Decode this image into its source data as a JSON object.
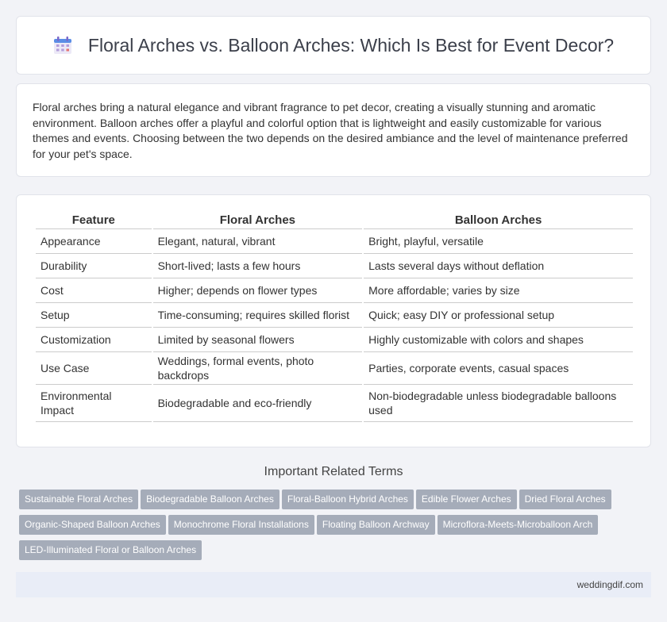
{
  "header": {
    "title": "Floral Arches vs. Balloon Arches: Which Is Best for Event Decor?",
    "icon": "calendar-icon"
  },
  "intro": {
    "text": "Floral arches bring a natural elegance and vibrant fragrance to pet decor, creating a visually stunning and aromatic environment. Balloon arches offer a playful and colorful option that is lightweight and easily customizable for various themes and events. Choosing between the two depends on the desired ambiance and the level of maintenance preferred for your pet's space."
  },
  "table": {
    "headers": [
      "Feature",
      "Floral Arches",
      "Balloon Arches"
    ],
    "rows": [
      [
        "Appearance",
        "Elegant, natural, vibrant",
        "Bright, playful, versatile"
      ],
      [
        "Durability",
        "Short-lived; lasts a few hours",
        "Lasts several days without deflation"
      ],
      [
        "Cost",
        "Higher; depends on flower types",
        "More affordable; varies by size"
      ],
      [
        "Setup",
        "Time-consuming; requires skilled florist",
        "Quick; easy DIY or professional setup"
      ],
      [
        "Customization",
        "Limited by seasonal flowers",
        "Highly customizable with colors and shapes"
      ],
      [
        "Use Case",
        "Weddings, formal events, photo backdrops",
        "Parties, corporate events, casual spaces"
      ],
      [
        "Environmental Impact",
        "Biodegradable and eco-friendly",
        "Non-biodegradable unless biodegradable balloons used"
      ]
    ]
  },
  "related": {
    "title": "Important Related Terms",
    "tags": [
      "Sustainable Floral Arches",
      "Biodegradable Balloon Arches",
      "Floral-Balloon Hybrid Arches",
      "Edible Flower Arches",
      "Dried Floral Arches",
      "Organic-Shaped Balloon Arches",
      "Monochrome Floral Installations",
      "Floating Balloon Archway",
      "Microflora-Meets-Microballoon Arch",
      "LED-Illuminated Floral or Balloon Arches"
    ]
  },
  "footer": {
    "site": "weddingdif.com"
  },
  "colors": {
    "tag_bg": "#a5acb9",
    "footer_bg": "#e9edf7",
    "page_bg": "#f2f3f7"
  }
}
